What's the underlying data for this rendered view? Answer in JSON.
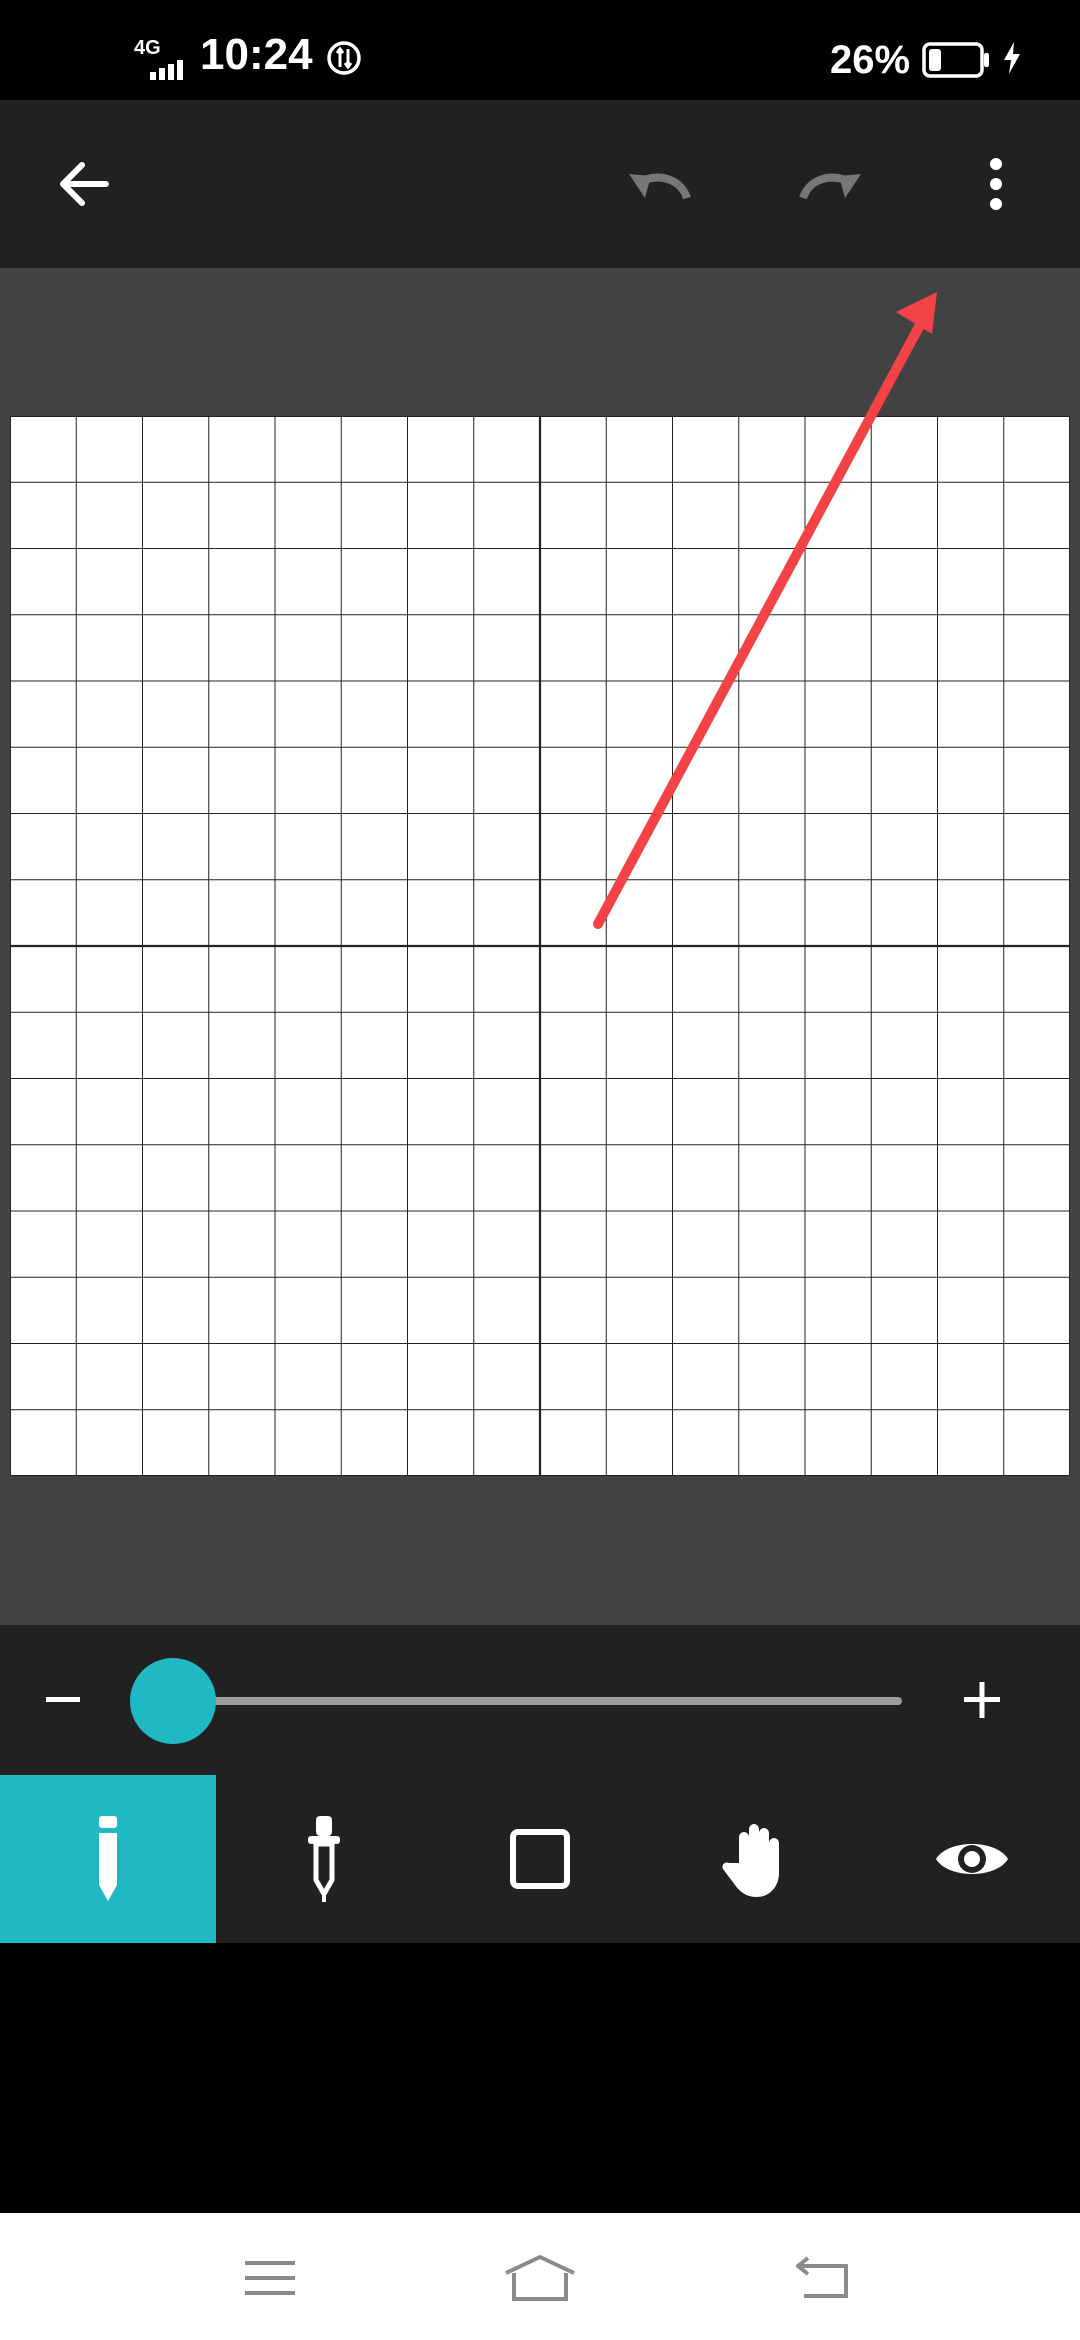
{
  "status_bar": {
    "network": "4G",
    "time": "10:24",
    "battery_percent": "26%",
    "battery_level": 0.26,
    "icons": [
      "signal-icon",
      "data-saver-icon",
      "battery-icon",
      "charging-icon"
    ]
  },
  "toolbar": {
    "icons": [
      "back-arrow-icon",
      "undo-icon",
      "redo-icon",
      "more-vert-icon"
    ],
    "undo_enabled": false,
    "redo_enabled": false
  },
  "canvas": {
    "columns": 16,
    "rows": 16
  },
  "zoom": {
    "minus_label": "−",
    "plus_label": "+",
    "level": 0.0
  },
  "tools": [
    {
      "id": "pencil",
      "icon": "pencil-icon",
      "active": true
    },
    {
      "id": "picker",
      "icon": "color-picker-icon",
      "active": false
    },
    {
      "id": "select",
      "icon": "square-select-icon",
      "active": false
    },
    {
      "id": "pan",
      "icon": "hand-icon",
      "active": false
    },
    {
      "id": "preview",
      "icon": "eye-icon",
      "active": false
    }
  ],
  "colors": {
    "accent": "#20b9c3",
    "toolbar": "#212121",
    "canvas_bg": "#424242",
    "annotation_arrow": "#f44346"
  }
}
